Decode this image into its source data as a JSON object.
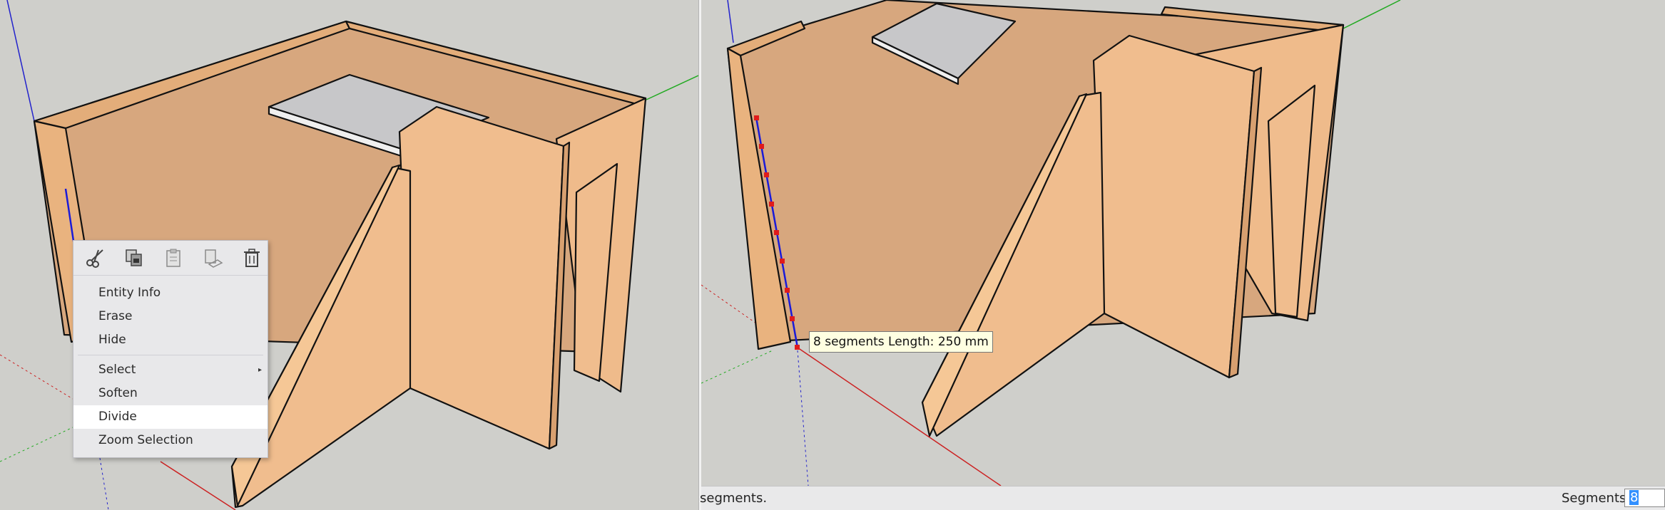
{
  "context_menu": {
    "toolbar_icons": [
      "scissors-icon",
      "copy-icon",
      "paste-icon",
      "paste-in-place-icon",
      "trash-icon"
    ],
    "items": [
      {
        "label": "Entity Info"
      },
      {
        "label": "Erase"
      },
      {
        "label": "Hide"
      },
      {
        "label": "Select",
        "submenu_arrow": "▸"
      },
      {
        "label": "Soften"
      },
      {
        "label": "Divide"
      },
      {
        "label": "Zoom Selection"
      }
    ],
    "highlighted_item": "Divide"
  },
  "tooltip": {
    "text": "8 segments Length: 250 mm"
  },
  "status_bar": {
    "message": "segments.",
    "vcb_label": "Segments",
    "vcb_value": "8"
  },
  "colors": {
    "background": "#cfcfcb",
    "wood_face": "#f0bd8e",
    "wood_shadow": "#d7a77e",
    "wood_top": "#e3ad7a",
    "shelf": "#c7c7c9",
    "axis_red": "#cc2222",
    "axis_green": "#22aa22",
    "axis_blue": "#2222cc",
    "highlight_edge": "#1a1ad8",
    "division_point": "#e01b1b"
  }
}
